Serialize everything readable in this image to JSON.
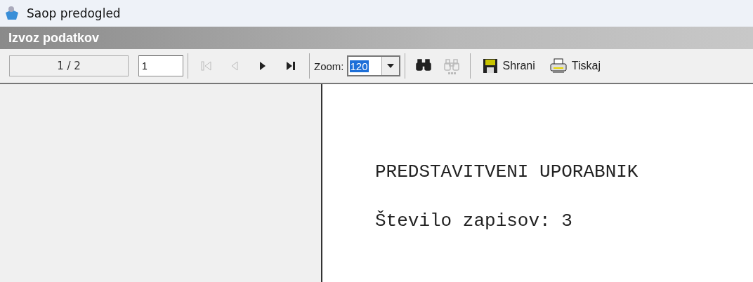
{
  "window": {
    "title": "Saop predogled"
  },
  "header": {
    "title": "Izvoz podatkov"
  },
  "toolbar": {
    "page_indicator": "1 / 2",
    "page_input": "1",
    "nav": [
      {
        "kind": "first",
        "disabled": true
      },
      {
        "kind": "prev",
        "disabled": true
      },
      {
        "kind": "next",
        "disabled": false
      },
      {
        "kind": "last",
        "disabled": false
      }
    ],
    "zoom": {
      "label": "Zoom:",
      "value": "120"
    },
    "find": [
      {
        "kind": "find",
        "disabled": false
      },
      {
        "kind": "find-next",
        "disabled": true
      }
    ],
    "actions": [
      {
        "kind": "save",
        "label": "Shrani"
      },
      {
        "kind": "print",
        "label": "Tiskaj"
      }
    ]
  },
  "page": {
    "lines": [
      "PREDSTAVITVENI UPORABNIK",
      "Število zapisov: 3"
    ]
  }
}
